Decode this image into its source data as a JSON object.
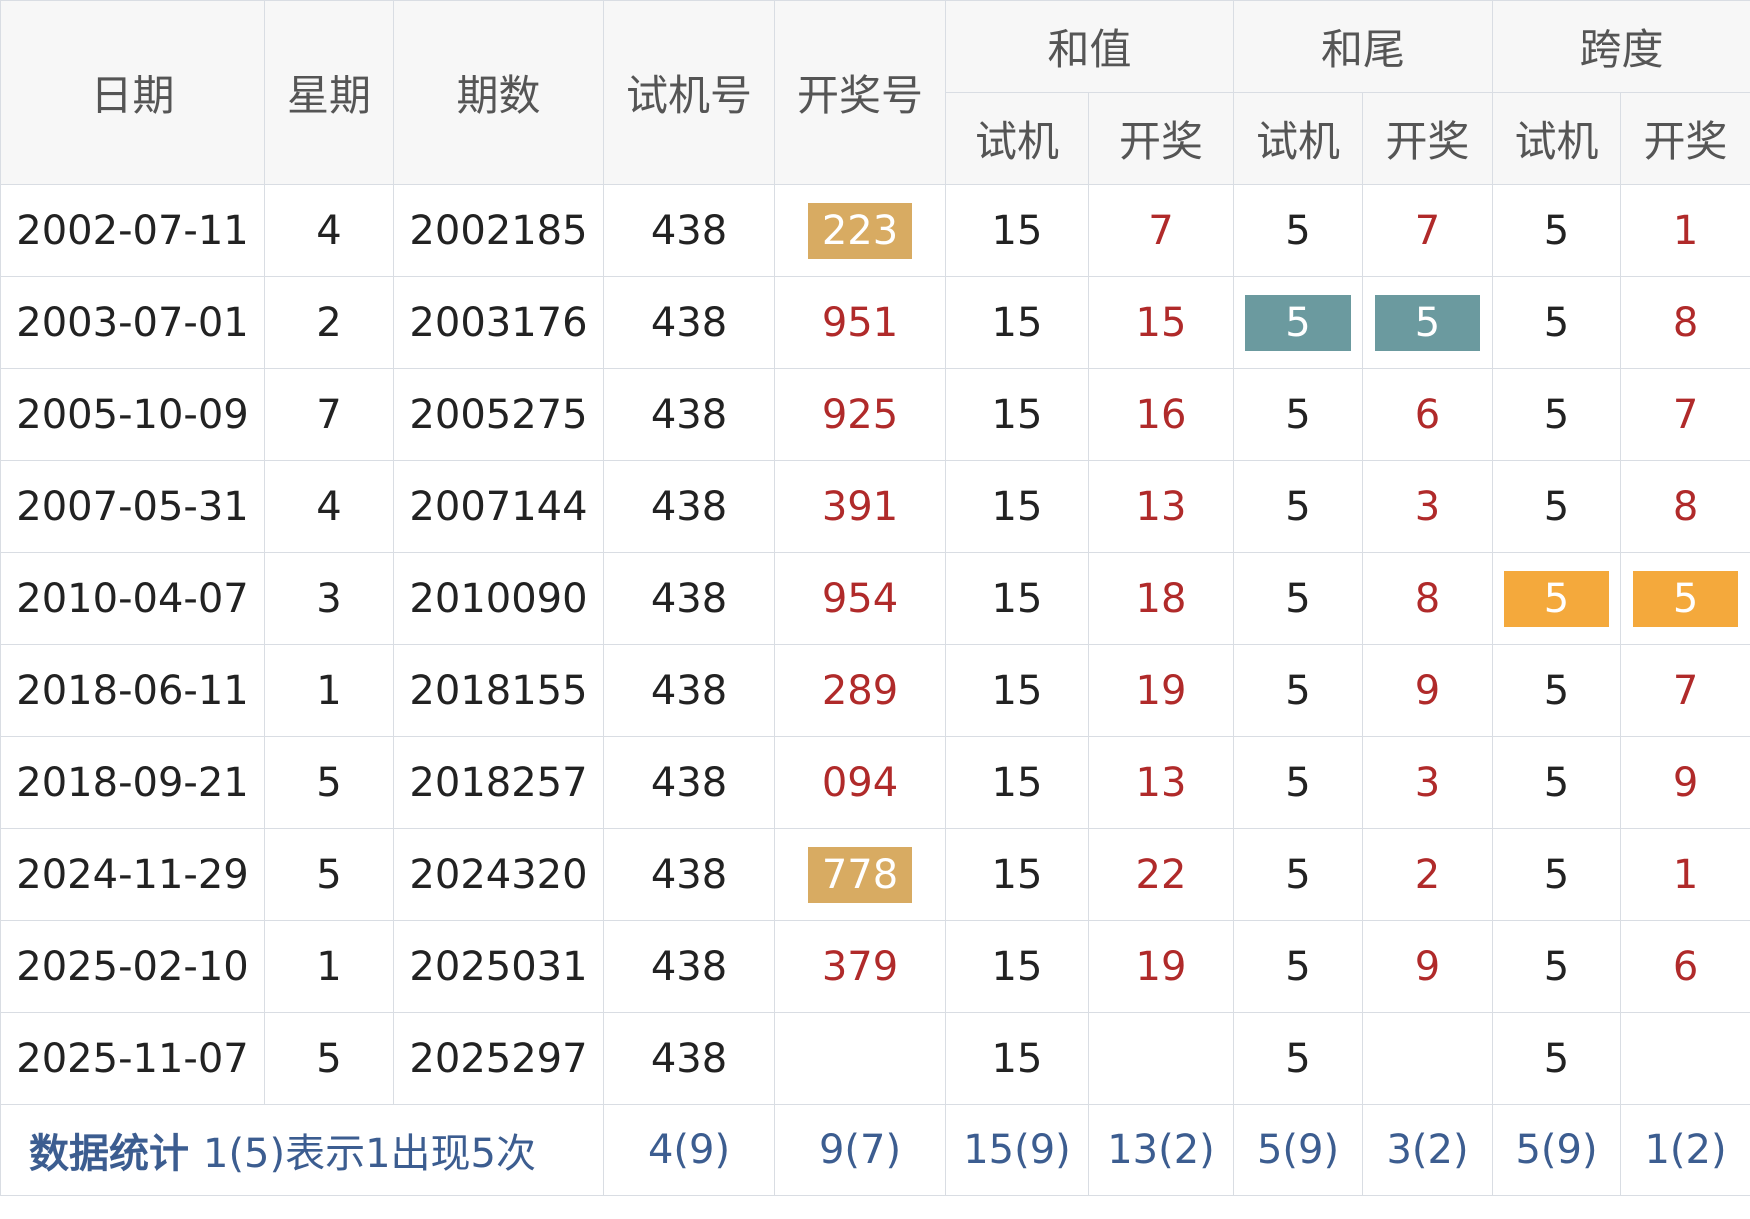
{
  "header": {
    "date": "日期",
    "weekday": "星期",
    "issue": "期数",
    "trial_number": "试机号",
    "draw_number": "开奖号",
    "sum_group": "和值",
    "tail_group": "和尾",
    "span_group": "跨度",
    "trial": "试机",
    "draw": "开奖"
  },
  "rows": [
    {
      "date": "2002-07-11",
      "weekday": "4",
      "issue": "2002185",
      "trial": "438",
      "draw": "223",
      "sum_trial": "15",
      "sum_draw": "7",
      "tail_trial": "5",
      "tail_draw": "7",
      "span_trial": "5",
      "span_draw": "1"
    },
    {
      "date": "2003-07-01",
      "weekday": "2",
      "issue": "2003176",
      "trial": "438",
      "draw": "951",
      "sum_trial": "15",
      "sum_draw": "15",
      "tail_trial": "5",
      "tail_draw": "5",
      "span_trial": "5",
      "span_draw": "8"
    },
    {
      "date": "2005-10-09",
      "weekday": "7",
      "issue": "2005275",
      "trial": "438",
      "draw": "925",
      "sum_trial": "15",
      "sum_draw": "16",
      "tail_trial": "5",
      "tail_draw": "6",
      "span_trial": "5",
      "span_draw": "7"
    },
    {
      "date": "2007-05-31",
      "weekday": "4",
      "issue": "2007144",
      "trial": "438",
      "draw": "391",
      "sum_trial": "15",
      "sum_draw": "13",
      "tail_trial": "5",
      "tail_draw": "3",
      "span_trial": "5",
      "span_draw": "8"
    },
    {
      "date": "2010-04-07",
      "weekday": "3",
      "issue": "2010090",
      "trial": "438",
      "draw": "954",
      "sum_trial": "15",
      "sum_draw": "18",
      "tail_trial": "5",
      "tail_draw": "8",
      "span_trial": "5",
      "span_draw": "5"
    },
    {
      "date": "2018-06-11",
      "weekday": "1",
      "issue": "2018155",
      "trial": "438",
      "draw": "289",
      "sum_trial": "15",
      "sum_draw": "19",
      "tail_trial": "5",
      "tail_draw": "9",
      "span_trial": "5",
      "span_draw": "7"
    },
    {
      "date": "2018-09-21",
      "weekday": "5",
      "issue": "2018257",
      "trial": "438",
      "draw": "094",
      "sum_trial": "15",
      "sum_draw": "13",
      "tail_trial": "5",
      "tail_draw": "3",
      "span_trial": "5",
      "span_draw": "9"
    },
    {
      "date": "2024-11-29",
      "weekday": "5",
      "issue": "2024320",
      "trial": "438",
      "draw": "778",
      "sum_trial": "15",
      "sum_draw": "22",
      "tail_trial": "5",
      "tail_draw": "2",
      "span_trial": "5",
      "span_draw": "1"
    },
    {
      "date": "2025-02-10",
      "weekday": "1",
      "issue": "2025031",
      "trial": "438",
      "draw": "379",
      "sum_trial": "15",
      "sum_draw": "19",
      "tail_trial": "5",
      "tail_draw": "9",
      "span_trial": "5",
      "span_draw": "6"
    },
    {
      "date": "2025-11-07",
      "weekday": "5",
      "issue": "2025297",
      "trial": "438",
      "draw": "",
      "sum_trial": "15",
      "sum_draw": "",
      "tail_trial": "5",
      "tail_draw": "",
      "span_trial": "5",
      "span_draw": ""
    }
  ],
  "footer": {
    "title": "数据统计",
    "note": "1(5)表示1出现5次",
    "trial": "4(9)",
    "draw": "9(7)",
    "sum_trial": "15(9)",
    "sum_draw": "13(2)",
    "tail_trial": "5(9)",
    "tail_draw": "3(2)",
    "span_trial": "5(9)",
    "span_draw": "1(2)"
  },
  "colors": {
    "gold_highlight": "#d8ab62",
    "teal_highlight": "#6b9a9f",
    "orange_highlight": "#f4a93c",
    "draw_text": "#b02a2a",
    "footer_text": "#3c5d90"
  }
}
